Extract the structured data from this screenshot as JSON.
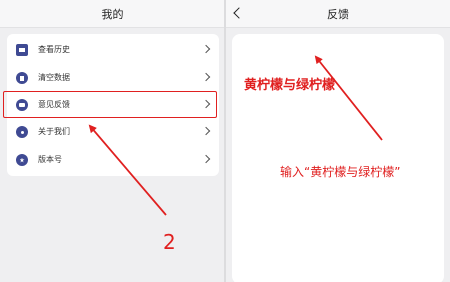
{
  "left_panel": {
    "title": "我的",
    "items": [
      {
        "label": "查看历史",
        "icon": "history-icon"
      },
      {
        "label": "清空数据",
        "icon": "trash-icon"
      },
      {
        "label": "意见反馈",
        "icon": "feedback-icon"
      },
      {
        "label": "关于我们",
        "icon": "info-icon"
      },
      {
        "label": "版本号",
        "icon": "star-icon"
      }
    ]
  },
  "right_panel": {
    "title": "反馈",
    "input_text": "黄柠檬与绿柠檬"
  },
  "annotations": {
    "instruction": "输入“黄柠檬与绿柠檬”",
    "step_number": "2"
  },
  "colors": {
    "accent": "#e02020",
    "icon": "#3f4a93",
    "panel_bg": "#efeff1"
  }
}
